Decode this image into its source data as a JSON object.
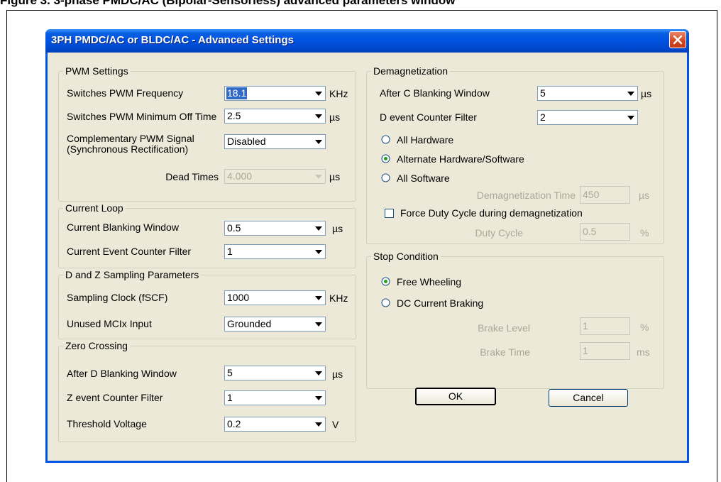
{
  "page_caption": "Figure 3. 3-phase PMDC/AC (Bipolar-Sensorless) advanced parameters window",
  "dialog": {
    "title": "3PH PMDC/AC or BLDC/AC - Advanced Settings",
    "ok_label": "OK",
    "cancel_label": "Cancel"
  },
  "pwm": {
    "group_label": "PWM Settings",
    "freq_label": "Switches PWM Frequency",
    "freq_value": "18.1",
    "freq_unit": "KHz",
    "min_off_label": "Switches PWM Minimum Off Time",
    "min_off_value": "2.5",
    "min_off_unit": "µs",
    "comp_label_1": "Complementary PWM Signal",
    "comp_label_2": "(Synchronous Rectification)",
    "comp_value": "Disabled",
    "dead_label": "Dead Times",
    "dead_value": "4.000",
    "dead_unit": "µs"
  },
  "current_loop": {
    "group_label": "Current Loop",
    "blank_label": "Current Blanking Window",
    "blank_value": "0.5",
    "blank_unit": "µs",
    "filter_label": "Current Event Counter Filter",
    "filter_value": "1"
  },
  "dz_sampling": {
    "group_label": "D and Z Sampling Parameters",
    "clock_label": "Sampling Clock (fSCF)",
    "clock_value": "1000",
    "clock_unit": "KHz",
    "mcix_label": "Unused MCIx Input",
    "mcix_value": "Grounded"
  },
  "zero_crossing": {
    "group_label": "Zero Crossing",
    "blank_label": "After D Blanking Window",
    "blank_value": "5",
    "blank_unit": "µs",
    "filter_label": "Z event Counter Filter",
    "filter_value": "1",
    "threshold_label": "Threshold Voltage",
    "threshold_value": "0.2",
    "threshold_unit": "V"
  },
  "demag": {
    "group_label": "Demagnetization",
    "blank_label": "After C Blanking Window",
    "blank_value": "5",
    "blank_unit": "µs",
    "filter_label": "D event Counter Filter",
    "filter_value": "2",
    "radio_all_hw": "All Hardware",
    "radio_alt": "Alternate Hardware/Software",
    "radio_all_sw": "All Software",
    "selected_mode": "Alternate Hardware/Software",
    "time_label": "Demagnetization Time",
    "time_value": "450",
    "time_unit": "µs",
    "force_label": "Force Duty Cycle during demagnetization",
    "force_checked": false,
    "duty_label": "Duty Cycle",
    "duty_value": "0.5",
    "duty_unit": "%"
  },
  "stop": {
    "group_label": "Stop Condition",
    "radio_free": "Free Wheeling",
    "radio_dc": "DC Current Braking",
    "selected_mode": "Free Wheeling",
    "brake_level_label": "Brake Level",
    "brake_level_value": "1",
    "brake_level_unit": "%",
    "brake_time_label": "Brake Time",
    "brake_time_value": "1",
    "brake_time_unit": "ms"
  }
}
